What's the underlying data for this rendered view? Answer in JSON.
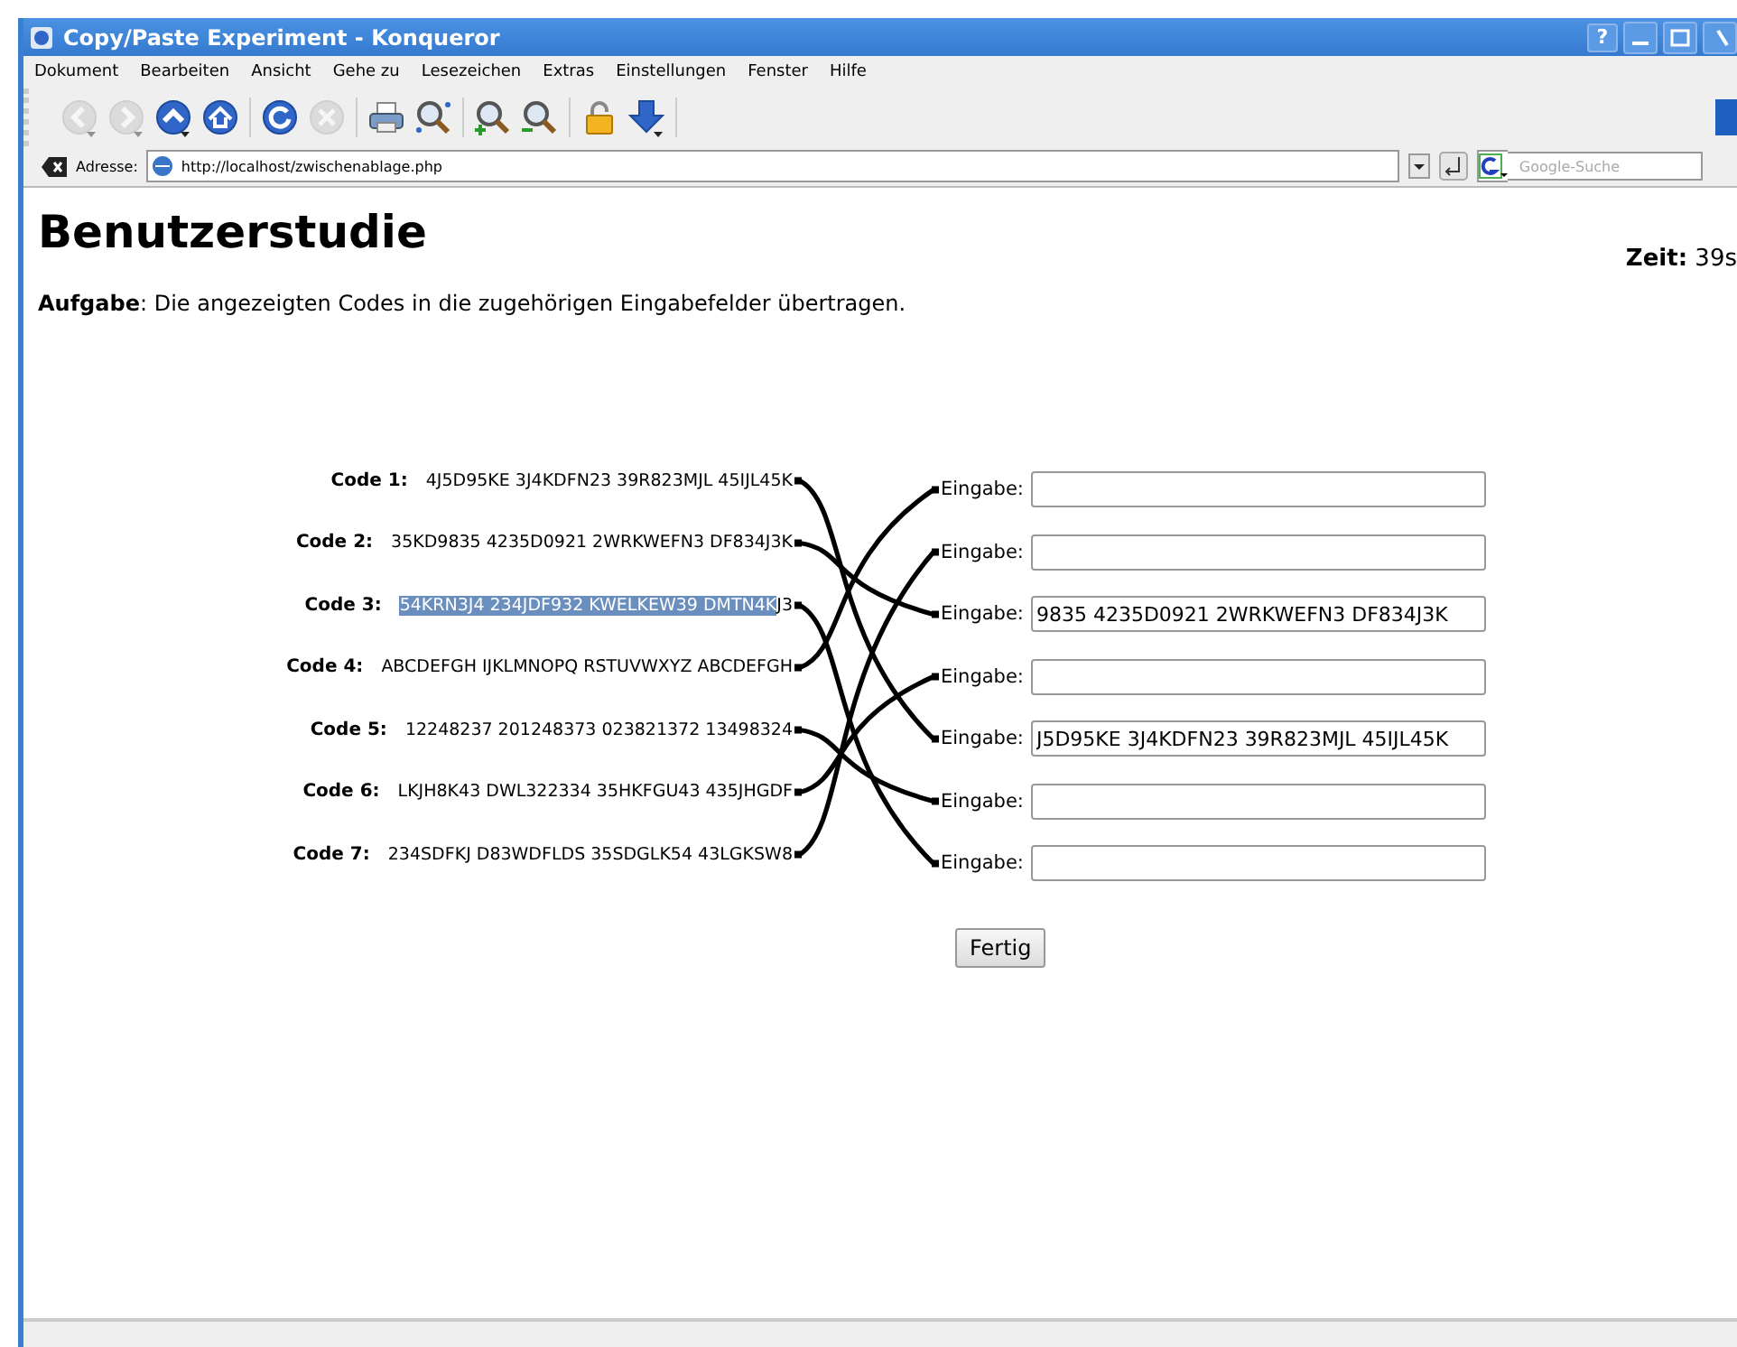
{
  "window": {
    "title": "Copy/Paste Experiment - Konqueror",
    "help_button": "?"
  },
  "menu": [
    "Dokument",
    "Bearbeiten",
    "Ansicht",
    "Gehe zu",
    "Lesezeichen",
    "Extras",
    "Einstellungen",
    "Fenster",
    "Hilfe"
  ],
  "toolbar": [
    [
      {
        "kind": "back",
        "disabled": true
      },
      {
        "kind": "forward",
        "disabled": true
      },
      {
        "kind": "up",
        "disabled": false
      },
      {
        "kind": "home",
        "disabled": false
      }
    ],
    [
      {
        "kind": "reload",
        "disabled": false
      },
      {
        "kind": "stop",
        "disabled": true
      }
    ],
    [
      {
        "kind": "print",
        "disabled": false
      },
      {
        "kind": "find",
        "disabled": false
      }
    ],
    [
      {
        "kind": "zoom_in",
        "disabled": false
      },
      {
        "kind": "zoom_out",
        "disabled": false
      }
    ],
    [
      {
        "kind": "lock",
        "disabled": false
      },
      {
        "kind": "download",
        "disabled": false
      }
    ]
  ],
  "address_bar": {
    "label": "Adresse:",
    "url": "http://localhost/zwischenablage.php"
  },
  "search": {
    "placeholder": "Google-Suche"
  },
  "page": {
    "heading": "Benutzerstudie",
    "timer_label": "Zeit:",
    "timer_value": "39s",
    "task": "**Aufgabe**: Die angezeigten Codes in die zugehörigen Eingabefelder übertragen."
  },
  "codes": [
    {
      "label": "Code 1:",
      "segments": [
        {
          "text": "4J5D95KE 3J4KDFN23 39R823MJL 45IJL45K",
          "selected": false
        }
      ]
    },
    {
      "label": "Code 2:",
      "segments": [
        {
          "text": "35KD9835 4235D0921 2WRKWEFN3 DF834J3K",
          "selected": false
        }
      ]
    },
    {
      "label": "Code 3:",
      "segments": [
        {
          "text": "54KRN3J4 234JDF932 KWELKEW39 DMTN4K",
          "selected": true
        },
        {
          "text": "J3",
          "selected": false
        }
      ]
    },
    {
      "label": "Code 4:",
      "segments": [
        {
          "text": "ABCDEFGH IJKLMNOPQ RSTUVWXYZ ABCDEFGH",
          "selected": false
        }
      ]
    },
    {
      "label": "Code 5:",
      "segments": [
        {
          "text": "12248237 201248373 023821372 13498324",
          "selected": false
        }
      ]
    },
    {
      "label": "Code 6:",
      "segments": [
        {
          "text": "LKJH8K43 DWL322334 35HKFGU43 435JHGDF",
          "selected": false
        }
      ]
    },
    {
      "label": "Code 7:",
      "segments": [
        {
          "text": "234SDFKJ D83WDFLDS 35SDGLK54 43LGKSW8",
          "selected": false
        }
      ]
    }
  ],
  "inputs": [
    {
      "label": "Eingabe:"
    },
    {
      "label": "Eingabe:"
    },
    {
      "label": "Eingabe:",
      "value": "9835 4235D0921 2WRKWEFN3 DF834J3K"
    },
    {
      "label": "Eingabe:"
    },
    {
      "label": "Eingabe:",
      "value": "J5D95KE 3J4KDFN23 39R823MJL 45IJL45K"
    },
    {
      "label": "Eingabe:"
    },
    {
      "label": "Eingabe:"
    }
  ],
  "submit_button": "Fertig"
}
